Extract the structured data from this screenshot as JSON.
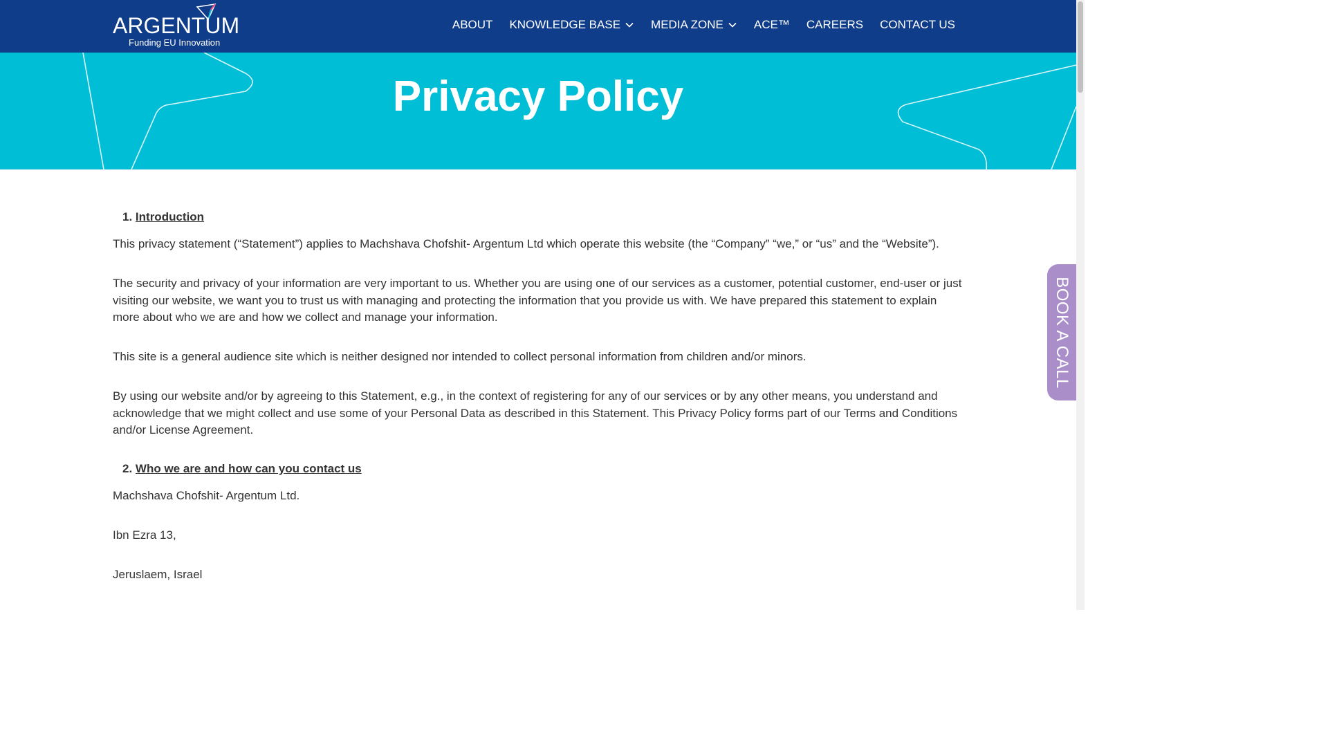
{
  "header": {
    "logo_word": "ARGENTUM",
    "logo_tagline": "Funding EU Innovation",
    "nav": [
      {
        "label": "ABOUT",
        "has_dropdown": false
      },
      {
        "label": "KNOWLEDGE BASE",
        "has_dropdown": true
      },
      {
        "label": "MEDIA ZONE",
        "has_dropdown": true
      },
      {
        "label": "ACE™",
        "has_dropdown": false
      },
      {
        "label": "CAREERS",
        "has_dropdown": false
      },
      {
        "label": "CONTACT US",
        "has_dropdown": false
      }
    ]
  },
  "hero": {
    "title": "Privacy Policy"
  },
  "content": {
    "section1": {
      "number": "1.",
      "title": "Introduction",
      "paragraphs": [
        "This privacy statement (“Statement”) applies to Machshava Chofshit- Argentum Ltd which operate this website (the “Company” “we,” or “us” and the “Website”).",
        "The security and privacy of your information are very important to us. Whether you are using one of our services as a customer, potential customer, end-user or just visiting our website, we want you to trust us with managing and protecting the information that you provide us with. We have prepared this statement to explain more about who we are and how we collect and manage your information.",
        "This site is a general audience site which is neither designed nor intended to collect personal information from children and/or minors.",
        "By using our website and/or by agreeing to this Statement, e.g., in the context of registering for any of our services or by any other means, you understand and acknowledge that we might collect and use some of your Personal Data as described in this Statement. This Privacy Policy forms part of our Terms and Conditions and/or License Agreement."
      ]
    },
    "section2": {
      "number": "2.",
      "title": "Who we are and how can you contact us",
      "lines": [
        "Machshava Chofshit- Argentum Ltd.",
        "Ibn Ezra 13,",
        "Jeruslaem, Israel"
      ]
    }
  },
  "book_call": {
    "label": "BOOK A CALL"
  },
  "colors": {
    "header_bg": "#0f3d8a",
    "hero_bg": "#00bed6",
    "book_call_bg": "#a98ec9",
    "text": "#333333"
  }
}
